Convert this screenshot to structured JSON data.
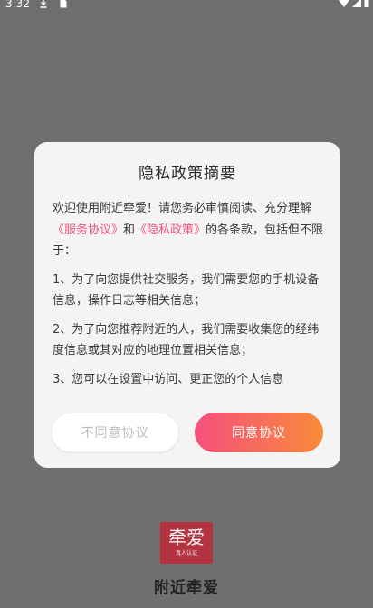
{
  "status_bar": {
    "time": "3:32"
  },
  "dialog": {
    "title": "隐私政策摘要",
    "intro_1": "欢迎使用附近牵爱！请您务必审慎阅读、充分理解",
    "service_link": "《服务协议》",
    "intro_and": "和",
    "privacy_link": "《隐私政策》",
    "intro_2": "的各条款，包括但不限于：",
    "item_1": "1、为了向您提供社交服务，我们需要您的手机设备信息，操作日志等相关信息；",
    "item_2": "2、为了向您推荐附近的人，我们需要收集您的经纬度信息或其对应的地理位置相关信息；",
    "item_3": "3、您可以在设置中访问、更正您的个人信息",
    "disagree_label": "不同意协议",
    "agree_label": "同意协议"
  },
  "branding": {
    "logo_text": "牵爱",
    "logo_subtext": "真人认证",
    "app_name": "附近牵爱"
  }
}
